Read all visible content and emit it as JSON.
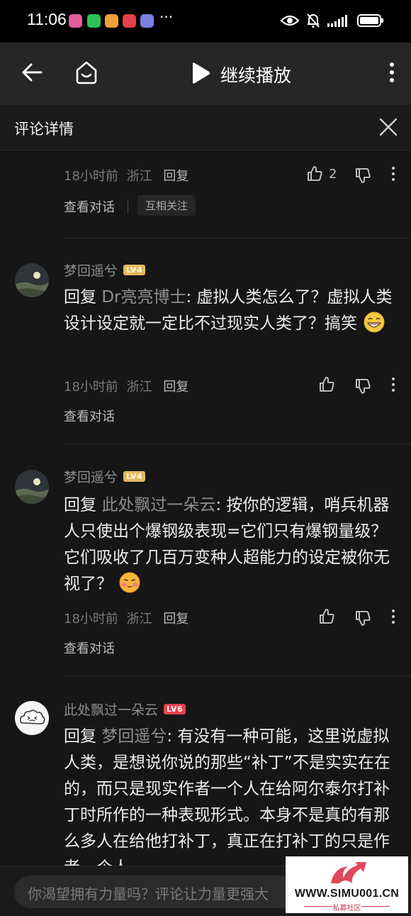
{
  "status_bar": {
    "time": "11:06",
    "more": "···",
    "app_icons": [
      "#e35d9c",
      "#2dc155",
      "#f0a23a",
      "#e3404a",
      "#7c7fe0"
    ]
  },
  "topbar": {
    "title": "继续播放"
  },
  "panel": {
    "title": "评论详情"
  },
  "comments": [
    {
      "time": "18小时前",
      "location": "浙江",
      "reply_label": "回复",
      "likes": "2",
      "view_conversation": "查看对话",
      "mutual_tag": "互相关注"
    },
    {
      "user": "梦回遥兮",
      "level": "LV4",
      "reply_prefix": "回复",
      "reply_to": "Dr亮亮博士",
      "text": ": 虚拟人类怎么了？虚拟人类设计设定就一定比不过现实人类了？搞笑",
      "emoji": "grinning-emoji",
      "time": "18小时前",
      "location": "浙江",
      "reply_label": "回复",
      "view_conversation": "查看对话"
    },
    {
      "user": "梦回遥兮",
      "level": "LV4",
      "reply_prefix": "回复",
      "reply_to": "此处飘过一朵云",
      "text": ": 按你的逻辑，哨兵机器人只使出个爆钢级表现=它们只有爆钢量级？它们吸收了几百万变种人超能力的设定被你无视了？",
      "emoji": "smirk-emoji",
      "time": "18小时前",
      "location": "浙江",
      "reply_label": "回复",
      "view_conversation": "查看对话"
    },
    {
      "user": "此处飘过一朵云",
      "level": "LV6",
      "reply_prefix": "回复",
      "reply_to": "梦回遥兮",
      "text": ": 有没有一种可能，这里说虚拟人类，是想说你说的那些“补丁”不是实实在在的，而只是现实作者一个人在给阿尔泰尔打补丁时所作的一种表现形式。本身不是真的有那么多人在给他打补丁，真正在打补丁的只是作者一个人"
    }
  ],
  "input": {
    "placeholder": "你渴望拥有力量吗？评论让力量更强大"
  },
  "watermark": {
    "url": "WWW.SIMU001.CN",
    "subtitle": "私募社区"
  }
}
